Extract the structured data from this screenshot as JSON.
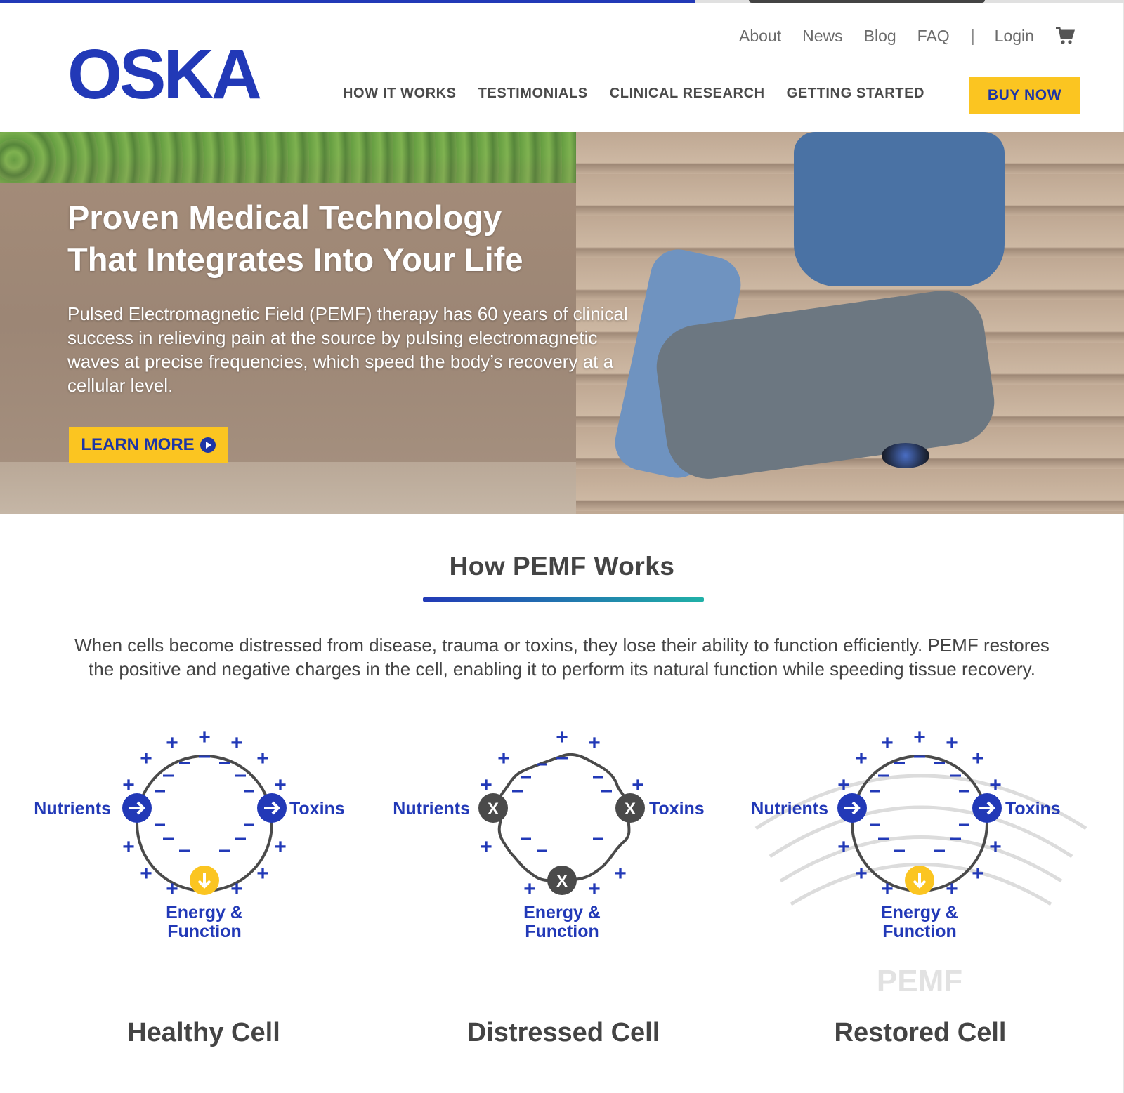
{
  "header": {
    "logo_text": "OSKA",
    "util_nav": [
      "About",
      "News",
      "Blog",
      "FAQ",
      "|",
      "Login"
    ],
    "main_nav": [
      "HOW IT WORKS",
      "TESTIMONIALS",
      "CLINICAL RESEARCH",
      "GETTING STARTED"
    ],
    "buy_label": "BUY NOW",
    "cart_icon": "cart-icon"
  },
  "hero": {
    "title_line1": "Proven Medical Technology",
    "title_line2": "That Integrates Into Your Life",
    "description": "Pulsed Electromagnetic Field (PEMF) therapy has 60 years of clinical success in relieving pain at the source by pulsing electromagnetic waves at precise frequencies, which speed the body’s recovery at a cellular level.",
    "cta_label": "LEARN MORE"
  },
  "section": {
    "title": "How PEMF Works",
    "description": "When cells become distressed from disease, trauma or toxins, they lose their ability to function efficiently. PEMF restores the positive and negative charges in the cell, enabling it to perform its natural function while speeding tissue recovery."
  },
  "cells": [
    {
      "title": "Healthy Cell",
      "left_label": "Nutrients",
      "right_label": "Toxins",
      "bottom_label_1": "Energy &",
      "bottom_label_2": "Function"
    },
    {
      "title": "Distressed Cell",
      "left_label": "Nutrients",
      "right_label": "Toxins",
      "bottom_label_1": "Energy &",
      "bottom_label_2": "Function"
    },
    {
      "title": "Restored Cell",
      "left_label": "Nutrients",
      "right_label": "Toxins",
      "bottom_label_1": "Energy &",
      "bottom_label_2": "Function",
      "pemf_label": "PEMF"
    }
  ],
  "colors": {
    "brand_blue": "#2239b7",
    "accent_yellow": "#fbc521",
    "text_gray": "#444444"
  }
}
